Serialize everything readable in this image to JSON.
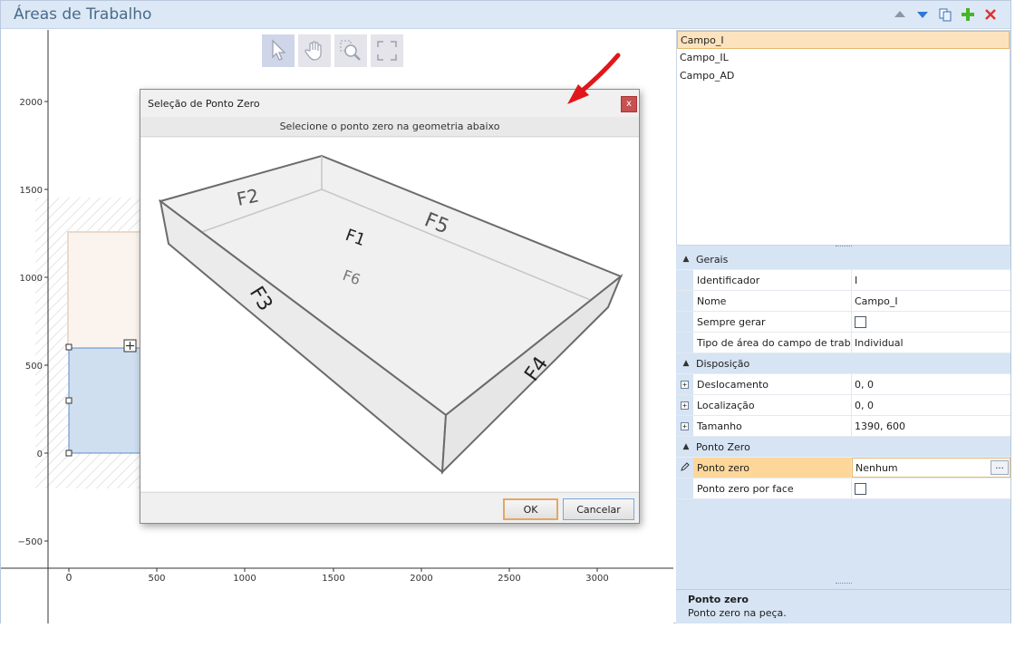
{
  "window": {
    "title": "Áreas de Trabalho"
  },
  "toolbar_icons": [
    "arrow-up-icon",
    "arrow-down-icon",
    "copy-icon",
    "add-icon",
    "delete-icon"
  ],
  "canvas_tools": [
    "pointer-tool-icon",
    "pan-hand-icon",
    "zoom-icon",
    "fit-view-icon"
  ],
  "axis": {
    "y_ticks": [
      "2000",
      "1500",
      "1000",
      "500",
      "0",
      "−500"
    ],
    "x_ticks": [
      "0",
      "500",
      "1000",
      "1500",
      "2000",
      "2500",
      "3000"
    ]
  },
  "list": {
    "items": [
      "Campo_I",
      "Campo_IL",
      "Campo_AD"
    ],
    "selected": 0
  },
  "properties": {
    "categories": [
      {
        "name": "Gerais",
        "rows": [
          {
            "label": "Identificador",
            "value": "I",
            "type": "text"
          },
          {
            "label": "Nome",
            "value": "Campo_I",
            "type": "text"
          },
          {
            "label": "Sempre gerar",
            "value": "",
            "type": "checkbox"
          },
          {
            "label": "Tipo de área do campo de traba…",
            "value": "Individual",
            "type": "text"
          }
        ]
      },
      {
        "name": "Disposição",
        "rows": [
          {
            "label": "Deslocamento",
            "value": "0, 0",
            "type": "expand"
          },
          {
            "label": "Localização",
            "value": "0, 0",
            "type": "expand"
          },
          {
            "label": "Tamanho",
            "value": "1390, 600",
            "type": "expand"
          }
        ]
      },
      {
        "name": "Ponto Zero",
        "rows": [
          {
            "label": "Ponto zero",
            "value": "Nenhum",
            "type": "selected"
          },
          {
            "label": "Ponto zero por face",
            "value": "",
            "type": "checkbox"
          }
        ]
      }
    ],
    "ellipsis": "..."
  },
  "help": {
    "title": "Ponto zero",
    "text": "Ponto zero na peça."
  },
  "dialog": {
    "title": "Seleção de Ponto Zero",
    "close": "x",
    "subtitle": "Selecione o ponto zero na geometria abaixo",
    "faces": [
      "F1",
      "F2",
      "F3",
      "F4",
      "F5",
      "F6"
    ],
    "ok": "OK",
    "cancel": "Cancelar"
  },
  "colors": {
    "annotation_arrow": "#e0161b",
    "selection_fill": "#cfdff0",
    "accent": "#e7b873"
  }
}
